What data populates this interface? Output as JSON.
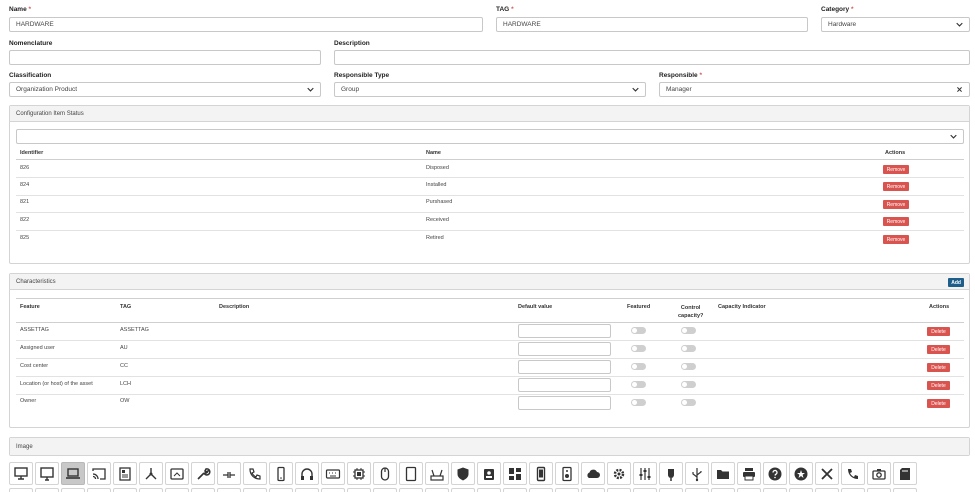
{
  "form": {
    "name": {
      "label": "Name",
      "required": "*",
      "value": "HARDWARE"
    },
    "tag": {
      "label": "TAG",
      "required": "*",
      "value": "HARDWARE"
    },
    "category": {
      "label": "Category",
      "required": "*",
      "value": "Hardware"
    },
    "nomenclature": {
      "label": "Nomenclature",
      "value": ""
    },
    "description": {
      "label": "Description",
      "value": ""
    },
    "classification": {
      "label": "Classification",
      "value": "Organization Product"
    },
    "responsible_type": {
      "label": "Responsible Type",
      "value": "Group"
    },
    "responsible": {
      "label": "Responsible",
      "required": "*",
      "value": "Manager"
    }
  },
  "ci_status": {
    "title": "Configuration Item Status",
    "select_value": "",
    "columns": {
      "identifier": "Identifier",
      "name": "Name",
      "actions": "Actions"
    },
    "remove_label": "Remove",
    "rows": [
      {
        "id": "826",
        "name": "Disposed"
      },
      {
        "id": "824",
        "name": "Installed"
      },
      {
        "id": "821",
        "name": "Purshased"
      },
      {
        "id": "822",
        "name": "Received"
      },
      {
        "id": "825",
        "name": "Retired"
      }
    ]
  },
  "characteristics": {
    "title": "Characteristics",
    "add_label": "Add",
    "columns": {
      "feature": "Feature",
      "tag": "TAG",
      "description": "Description",
      "default_value": "Default value",
      "featured": "Featured",
      "control_capacity_1": "Control",
      "control_capacity_2": "capacity?",
      "capacity_indicator": "Capacity Indicator",
      "actions": "Actions"
    },
    "delete_label": "Delete",
    "rows": [
      {
        "feature": "ASSETTAG",
        "tag": "ASSETTAG",
        "description": "",
        "default_value": "",
        "featured": false,
        "control": false
      },
      {
        "feature": "Assigned user",
        "tag": "AU",
        "description": "",
        "default_value": "",
        "featured": false,
        "control": false
      },
      {
        "feature": "Cost center",
        "tag": "CC",
        "description": "",
        "default_value": "",
        "featured": false,
        "control": false
      },
      {
        "feature": "Location (or host) of the asset",
        "tag": "LCH",
        "description": "",
        "default_value": "",
        "featured": false,
        "control": false
      },
      {
        "feature": "Owner",
        "tag": "OW",
        "description": "",
        "default_value": "",
        "featured": false,
        "control": false
      }
    ]
  },
  "image": {
    "title": "Image",
    "selected": "laptop-icon",
    "icons": [
      "desktop-icon",
      "monitor-icon",
      "laptop-icon",
      "cast-icon",
      "motherboard-icon",
      "network-icon",
      "screen-icon",
      "wrench-icon",
      "connector-icon",
      "phone-call-icon",
      "mobile-icon",
      "headphones-icon",
      "keyboard-icon",
      "cpu-icon",
      "mouse-icon",
      "tablet-icon",
      "router-icon",
      "shield-icon",
      "badge-icon",
      "dashboard-icon",
      "smartphone-icon",
      "speaker-icon",
      "cloud-icon",
      "gear-icon",
      "equalizer-icon",
      "plug-icon",
      "usb-icon",
      "folder-icon",
      "printer-icon",
      "question-icon",
      "star-icon",
      "tools-icon",
      "phone-icon",
      "camera-icon",
      "sd-card-icon"
    ]
  },
  "colors": {
    "danger": "#d9534f",
    "primary": "#1d5f8a",
    "selected_tile": "#c8c8c8"
  }
}
